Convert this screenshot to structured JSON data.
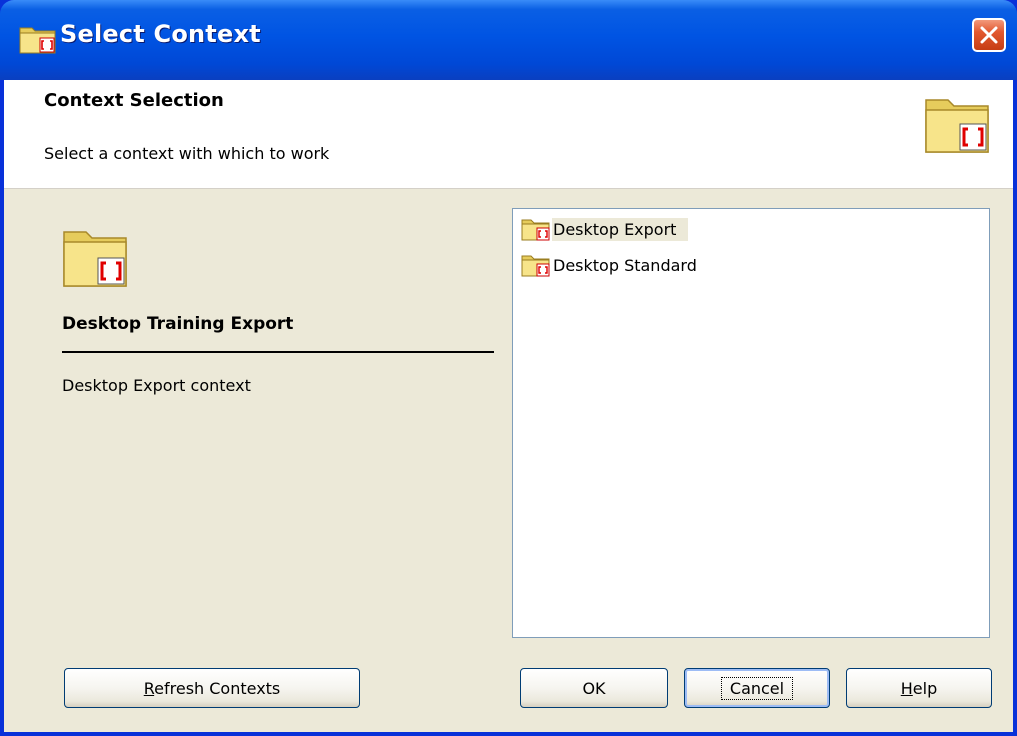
{
  "window": {
    "title": "Select Context",
    "close_icon": "close-icon"
  },
  "header": {
    "title": "Context Selection",
    "subtitle": "Select a context with which to work",
    "icon": "context-folder-icon"
  },
  "details": {
    "icon": "context-folder-icon",
    "name": "Desktop Training Export",
    "description": "Desktop Export context"
  },
  "contexts": {
    "items": [
      {
        "label": "Desktop Export",
        "icon": "context-folder-icon",
        "selected": true
      },
      {
        "label": "Desktop Standard",
        "icon": "context-folder-icon",
        "selected": false
      }
    ]
  },
  "buttons": {
    "refresh": {
      "accel": "R",
      "rest": "efresh Contexts"
    },
    "ok": {
      "label": "OK"
    },
    "cancel": {
      "label": "Cancel"
    },
    "help": {
      "accel": "H",
      "rest": "elp"
    }
  },
  "colors": {
    "titlebar": "#0054e3",
    "dialog_bg": "#ece9d8",
    "close_button": "#e2582f",
    "icon_accent": "#e00000"
  }
}
